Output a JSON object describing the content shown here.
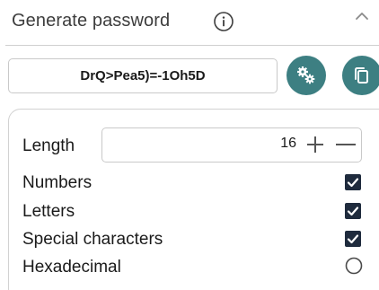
{
  "header": {
    "title": "Generate password",
    "info_icon": "info-circle-icon",
    "collapse_icon": "chevron-up-icon"
  },
  "password": {
    "value": "DrQ>Pea5)=-1Oh5D"
  },
  "buttons": {
    "generate_icon": "gears-icon",
    "copy_icon": "copy-icon",
    "accent_color": "#3d7f82"
  },
  "settings": {
    "length_label": "Length",
    "length_value": "16",
    "options": [
      {
        "label": "Numbers",
        "control": "checkbox",
        "checked": true
      },
      {
        "label": "Letters",
        "control": "checkbox",
        "checked": true
      },
      {
        "label": "Special characters",
        "control": "checkbox",
        "checked": true
      },
      {
        "label": "Hexadecimal",
        "control": "radio",
        "checked": false
      }
    ]
  }
}
